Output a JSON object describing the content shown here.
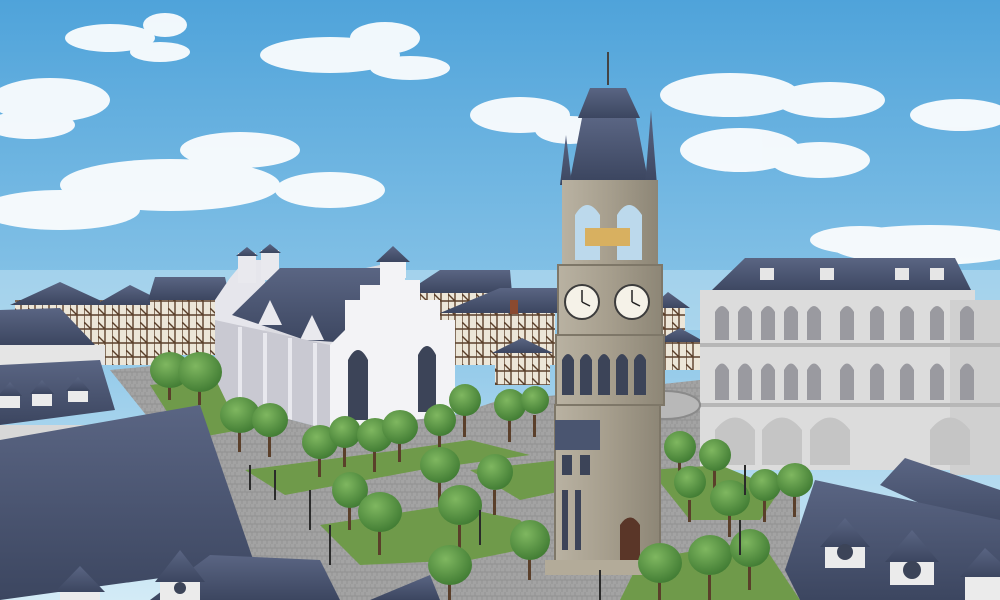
{
  "scene": {
    "elements": [
      "sky",
      "clouds",
      "timber-frame-houses",
      "white-gothic-church",
      "clock-tower",
      "classical-palace",
      "town-square",
      "trees",
      "street-lamps",
      "foreground-roofs"
    ]
  },
  "clock_tower": {
    "clock_faces": 2,
    "bell_color": "#d8b060",
    "stone_color": "#a8a090"
  },
  "colors": {
    "sky_top": "#4fa3da",
    "sky_bottom": "#c6e3f2",
    "roof": "#4a5570",
    "grass": "#6f9a4a",
    "tree": "#4e8a3a",
    "cobble": "#9a9a9a",
    "church_wall": "#f1f1f4",
    "palace_wall": "#e0e0e0"
  }
}
